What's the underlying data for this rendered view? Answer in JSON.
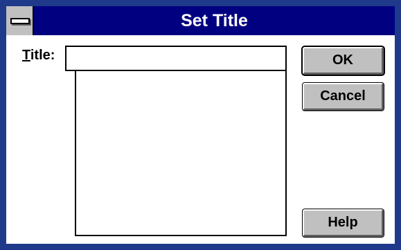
{
  "window": {
    "title": "Set Title"
  },
  "form": {
    "title_label_accel": "T",
    "title_label_rest": "itle:",
    "title_value": "",
    "title_list_items": []
  },
  "buttons": {
    "ok_label": "OK",
    "cancel_label": "Cancel",
    "help_label": "Help"
  },
  "colors": {
    "titlebar": "#000080",
    "button_face": "#c0c0c0"
  }
}
